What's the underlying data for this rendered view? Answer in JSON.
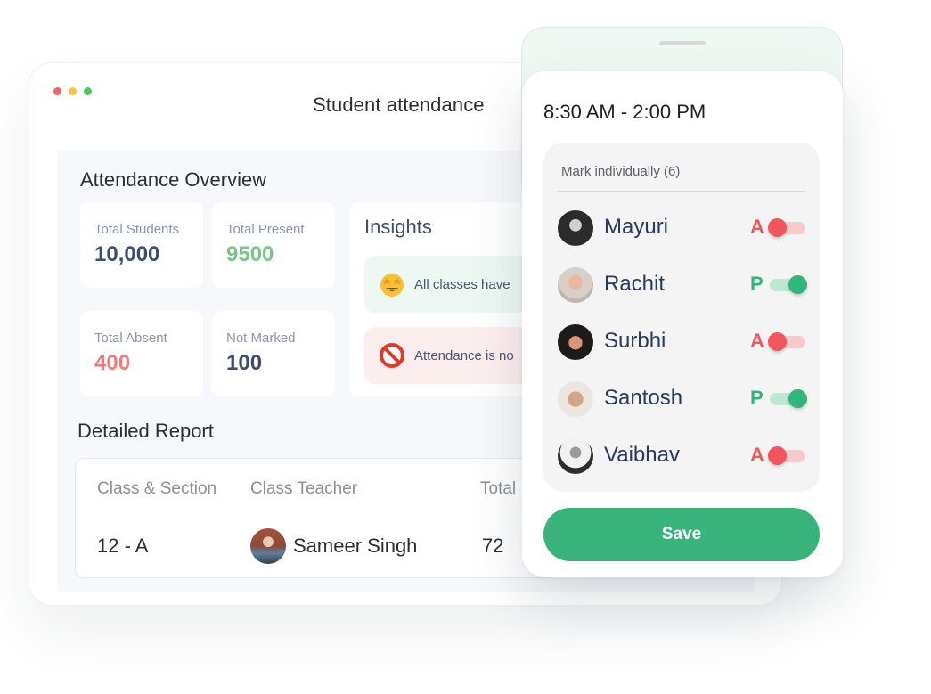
{
  "window": {
    "title": "Student attendance",
    "traffic_lights": [
      "#f56565",
      "#f6c343",
      "#4cc85a"
    ]
  },
  "overview": {
    "title": "Attendance Overview",
    "stats": [
      {
        "label": "Total Students",
        "value": "10,000",
        "color": "#3f4d6b"
      },
      {
        "label": "Total Present",
        "value": "9500",
        "color": "#7cc48a"
      },
      {
        "label": "Total Absent",
        "value": "400",
        "color": "#ee7c7c"
      },
      {
        "label": "Not Marked",
        "value": "100",
        "color": "#3f4d6b"
      }
    ]
  },
  "insights": {
    "title": "Insights",
    "items": [
      {
        "icon": "star-struck-emoji-icon",
        "text": "All classes have",
        "bg": "#edf8f2"
      },
      {
        "icon": "prohibited-icon",
        "text": "Attendance is no",
        "bg": "#fdeeee"
      }
    ]
  },
  "report": {
    "title": "Detailed Report",
    "columns": [
      "Class & Section",
      "Class Teacher",
      "Total"
    ],
    "rows": [
      {
        "class_section": "12 - A",
        "teacher": "Sameer Singh",
        "total": "72"
      }
    ]
  },
  "phone": {
    "time_range": "8:30 AM - 2:00 PM",
    "mark_label": "Mark individually (6)",
    "students": [
      {
        "name": "Mayuri",
        "status": "A",
        "present": false
      },
      {
        "name": "Rachit",
        "status": "P",
        "present": true
      },
      {
        "name": "Surbhi",
        "status": "A",
        "present": false
      },
      {
        "name": "Santosh",
        "status": "P",
        "present": true
      },
      {
        "name": "Vaibhav",
        "status": "A",
        "present": false
      }
    ],
    "save_label": "Save"
  },
  "colors": {
    "present": "#31b57a",
    "present_track": "#bfe6d3",
    "absent": "#f2555c",
    "absent_track": "#f8c9cc",
    "accent": "#38b37c"
  }
}
